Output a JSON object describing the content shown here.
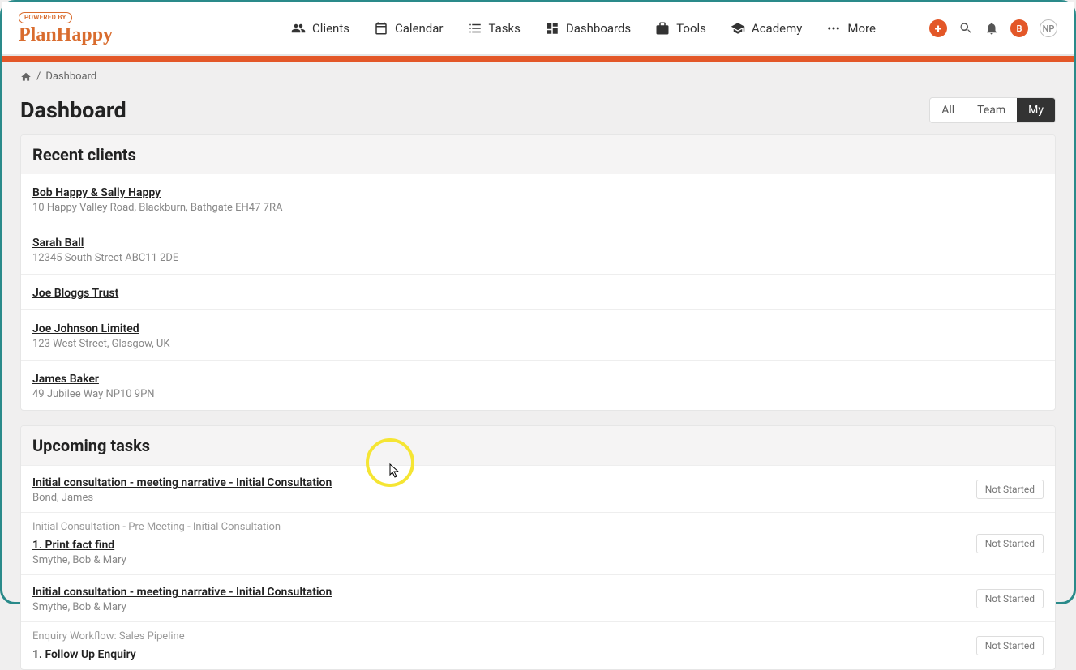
{
  "logo": {
    "badge": "POWERED BY",
    "text": "PlanHappy"
  },
  "nav": {
    "clients": "Clients",
    "calendar": "Calendar",
    "tasks": "Tasks",
    "dashboards": "Dashboards",
    "tools": "Tools",
    "academy": "Academy",
    "more": "More"
  },
  "header": {
    "badge1": "B",
    "badge2": "NP"
  },
  "breadcrumb": {
    "current": "Dashboard"
  },
  "page": {
    "title": "Dashboard"
  },
  "tabs": {
    "all": "All",
    "team": "Team",
    "my": "My"
  },
  "recent": {
    "title": "Recent clients",
    "items": [
      {
        "name": "Bob Happy & Sally Happy",
        "address": "10 Happy Valley Road, Blackburn, Bathgate EH47 7RA"
      },
      {
        "name": "Sarah Ball",
        "address": "12345 South Street ABC11 2DE"
      },
      {
        "name": "Joe Bloggs Trust",
        "address": ""
      },
      {
        "name": "Joe Johnson Limited",
        "address": "123 West Street, Glasgow, UK"
      },
      {
        "name": "James Baker",
        "address": "49 Jubilee Way NP10 9PN"
      }
    ]
  },
  "upcoming": {
    "title": "Upcoming tasks",
    "items": [
      {
        "context": "",
        "link": "Initial consultation - meeting narrative - Initial Consultation",
        "client": "Bond, James",
        "status": "Not Started"
      },
      {
        "context": "Initial Consultation - Pre Meeting - Initial Consultation",
        "link": "1. Print fact find",
        "client": "Smythe, Bob & Mary",
        "status": "Not Started"
      },
      {
        "context": "",
        "link": "Initial consultation - meeting narrative - Initial Consultation",
        "client": "Smythe, Bob & Mary",
        "status": "Not Started"
      },
      {
        "context": "Enquiry Workflow: Sales Pipeline",
        "link": "1. Follow Up Enquiry",
        "client": "",
        "status": "Not Started"
      }
    ]
  }
}
